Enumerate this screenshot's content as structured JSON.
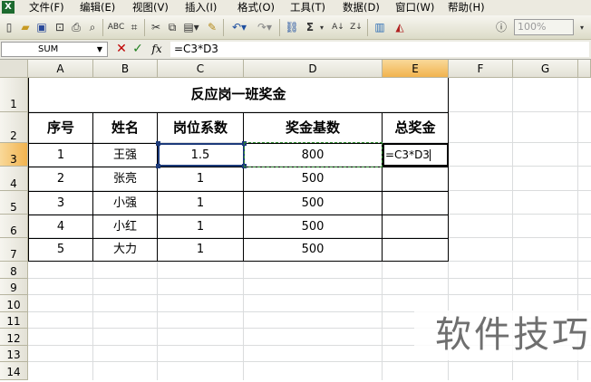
{
  "menu": [
    "文件(F)",
    "编辑(E)",
    "视图(V)",
    "插入(I)",
    "格式(O)",
    "工具(T)",
    "数据(D)",
    "窗口(W)",
    "帮助(H)"
  ],
  "toolbar": {
    "sigma": "Σ",
    "zoom": "100%"
  },
  "formula_bar": {
    "name_box": "SUM",
    "fx": "fx",
    "cancel": "✕",
    "enter": "✓",
    "formula": "=C3*D3"
  },
  "columns": [
    "A",
    "B",
    "C",
    "D",
    "E",
    "F",
    "G"
  ],
  "rows": [
    "1",
    "2",
    "3",
    "4",
    "5",
    "6",
    "7",
    "8",
    "9",
    "10",
    "11",
    "12",
    "13",
    "14"
  ],
  "sheet": {
    "title": "反应岗一班奖金",
    "headers": [
      "序号",
      "姓名",
      "岗位系数",
      "奖金基数",
      "总奖金"
    ],
    "data": [
      [
        "1",
        "王强",
        "1.5",
        "800"
      ],
      [
        "2",
        "张亮",
        "1",
        "500"
      ],
      [
        "3",
        "小强",
        "1",
        "500"
      ],
      [
        "4",
        "小红",
        "1",
        "500"
      ],
      [
        "5",
        "大力",
        "1",
        "500"
      ]
    ],
    "editing_value": "=C3*D3"
  },
  "watermark": "软件技巧"
}
